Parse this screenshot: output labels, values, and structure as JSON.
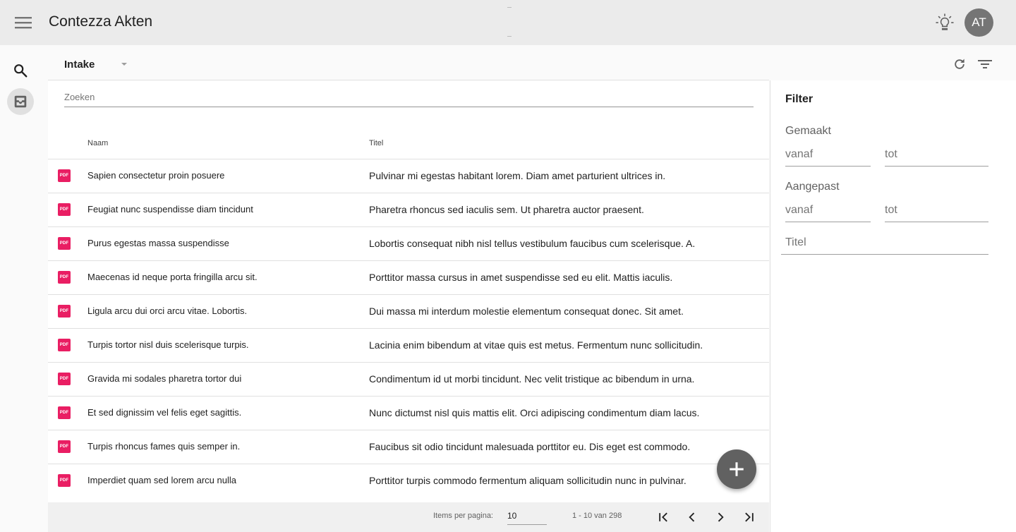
{
  "app": {
    "title": "Contezza Akten"
  },
  "header": {
    "user_initials": "AT",
    "icons": {
      "menu": "menu-icon",
      "theme": "lightbulb-icon"
    }
  },
  "rail": {
    "items": [
      {
        "name": "search",
        "icon": "search-icon",
        "active": false
      },
      {
        "name": "inbox",
        "icon": "inbox-icon",
        "active": true
      }
    ]
  },
  "toolbar": {
    "folder": "Intake",
    "icons": {
      "refresh": "refresh-icon",
      "filter": "filter-icon"
    }
  },
  "search": {
    "placeholder": "Zoeken",
    "value": ""
  },
  "table": {
    "columns": {
      "name": "Naam",
      "title": "Titel"
    },
    "file_badge": "PDF",
    "rows": [
      {
        "name": "Sapien consectetur proin posuere",
        "title": "Pulvinar mi egestas habitant lorem. Diam amet parturient ultrices in."
      },
      {
        "name": "Feugiat nunc suspendisse diam tincidunt",
        "title": "Pharetra rhoncus sed iaculis sem. Ut pharetra auctor praesent."
      },
      {
        "name": "Purus egestas massa suspendisse",
        "title": "Lobortis consequat nibh nisl tellus vestibulum faucibus cum scelerisque. A."
      },
      {
        "name": "Maecenas id neque porta fringilla arcu sit.",
        "title": "Porttitor massa cursus in amet suspendisse sed eu elit. Mattis iaculis."
      },
      {
        "name": "Ligula arcu dui orci arcu vitae. Lobortis.",
        "title": "Dui massa mi interdum molestie elementum consequat donec. Sit amet."
      },
      {
        "name": "Turpis tortor nisl duis scelerisque turpis.",
        "title": "Lacinia enim bibendum at vitae quis est metus. Fermentum nunc sollicitudin."
      },
      {
        "name": "Gravida mi sodales pharetra tortor dui",
        "title": "Condimentum id ut morbi tincidunt. Nec velit tristique ac bibendum in urna."
      },
      {
        "name": "Et sed dignissim vel felis eget sagittis.",
        "title": "Nunc dictumst nisl quis mattis elit. Orci adipiscing condimentum diam lacus."
      },
      {
        "name": "Turpis rhoncus fames quis semper in.",
        "title": "Faucibus sit odio tincidunt malesuada porttitor eu. Dis eget est commodo."
      },
      {
        "name": "Imperdiet quam sed lorem arcu nulla",
        "title": "Porttitor turpis commodo fermentum aliquam sollicitudin nunc in pulvinar."
      }
    ]
  },
  "paginator": {
    "items_per_page_label": "Items per pagina:",
    "items_per_page": "10",
    "range": "1 - 10 van 298"
  },
  "filter": {
    "title": "Filter",
    "created_label": "Gemaakt",
    "modified_label": "Aangepast",
    "from_placeholder": "vanaf",
    "to_placeholder": "tot",
    "title_placeholder": "Titel"
  },
  "colors": {
    "accent": "#e91e63",
    "fab": "#616161",
    "appbar": "#ebebeb"
  }
}
